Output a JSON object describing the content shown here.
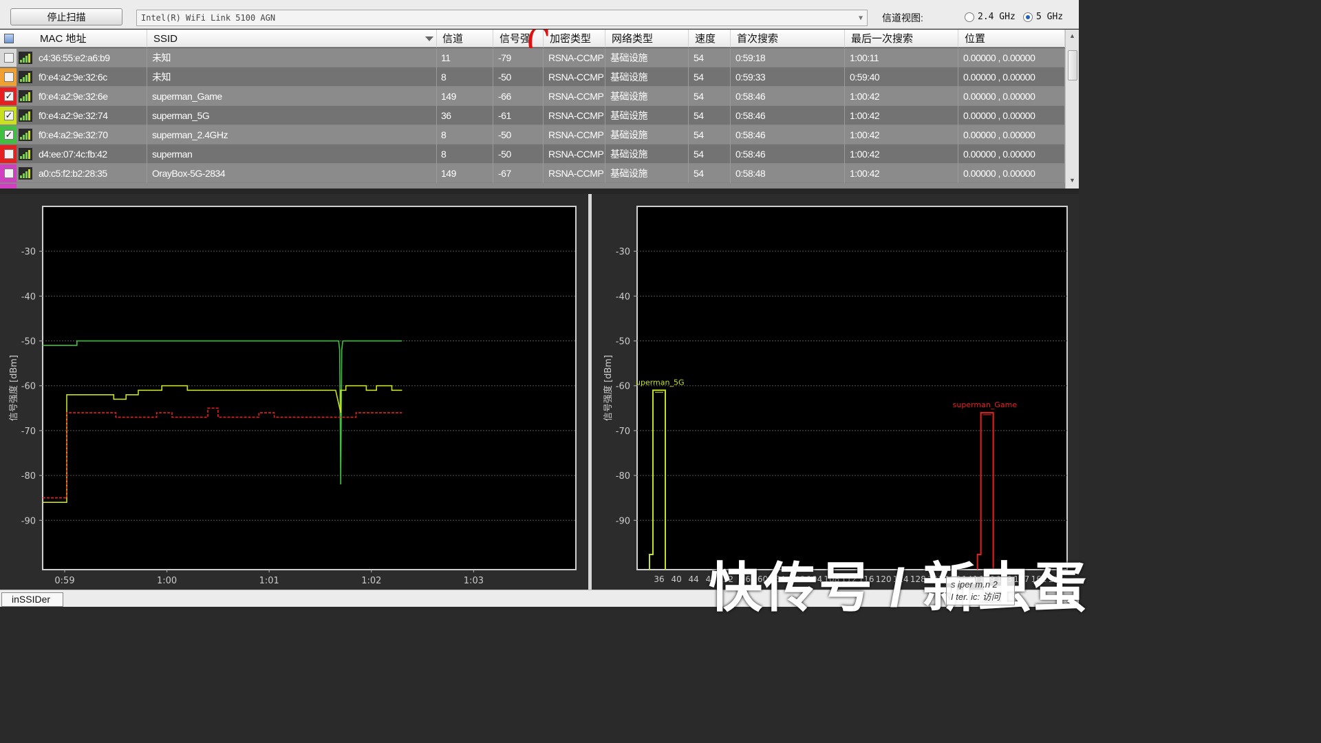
{
  "toolbar": {
    "stop_scan_label": "停止扫描",
    "adapter_value": "Intel(R) WiFi Link 5100 AGN",
    "channel_view_label": "信道视图:",
    "band_24_label": "2.4 GHz",
    "band_5_label": "5 GHz",
    "selected_band": "5 GHz"
  },
  "table": {
    "columns": [
      "MAC 地址",
      "SSID",
      "信道",
      "信号强",
      "加密类型",
      "网络类型",
      "速度",
      "首次搜索",
      "最后一次搜索",
      "位置"
    ],
    "overlay_mark": "C",
    "rows": [
      {
        "color": "#d8d8d8",
        "checked": false,
        "mac": "c4:36:55:e2:a6:b9",
        "ssid": "未知",
        "channel": "11",
        "rssi": "-79",
        "security": "RSNA-CCMP",
        "network": "基础设施",
        "speed": "54",
        "first_seen": "0:59:18",
        "last_seen": "1:00:11",
        "location": "0.00000 , 0.00000"
      },
      {
        "color": "#f0a030",
        "checked": false,
        "mac": "f0:e4:a2:9e:32:6c",
        "ssid": "未知",
        "channel": "8",
        "rssi": "-50",
        "security": "RSNA-CCMP",
        "network": "基础设施",
        "speed": "54",
        "first_seen": "0:59:33",
        "last_seen": "0:59:40",
        "location": "0.00000 , 0.00000"
      },
      {
        "color": "#e62020",
        "checked": true,
        "mac": "f0:e4:a2:9e:32:6e",
        "ssid": "superman_Game",
        "channel": "149",
        "rssi": "-66",
        "security": "RSNA-CCMP",
        "network": "基础设施",
        "speed": "54",
        "first_seen": "0:58:46",
        "last_seen": "1:00:42",
        "location": "0.00000 , 0.00000"
      },
      {
        "color": "#c8e020",
        "checked": true,
        "mac": "f0:e4:a2:9e:32:74",
        "ssid": "superman_5G",
        "channel": "36",
        "rssi": "-61",
        "security": "RSNA-CCMP",
        "network": "基础设施",
        "speed": "54",
        "first_seen": "0:58:46",
        "last_seen": "1:00:42",
        "location": "0.00000 , 0.00000"
      },
      {
        "color": "#40c040",
        "checked": true,
        "mac": "f0:e4:a2:9e:32:70",
        "ssid": "superman_2.4GHz",
        "channel": "8",
        "rssi": "-50",
        "security": "RSNA-CCMP",
        "network": "基础设施",
        "speed": "54",
        "first_seen": "0:58:46",
        "last_seen": "1:00:42",
        "location": "0.00000 , 0.00000"
      },
      {
        "color": "#e62020",
        "checked": false,
        "mac": "d4:ee:07:4c:fb:42",
        "ssid": "superman",
        "channel": "8",
        "rssi": "-50",
        "security": "RSNA-CCMP",
        "network": "基础设施",
        "speed": "54",
        "first_seen": "0:58:46",
        "last_seen": "1:00:42",
        "location": "0.00000 , 0.00000"
      },
      {
        "color": "#d040c0",
        "checked": false,
        "mac": "a0:c5:f2:b2:28:35",
        "ssid": "OrayBox-5G-2834",
        "channel": "149",
        "rssi": "-67",
        "security": "RSNA-CCMP",
        "network": "基础设施",
        "speed": "54",
        "first_seen": "0:58:48",
        "last_seen": "1:00:42",
        "location": "0.00000 , 0.00000"
      }
    ]
  },
  "chart_data": [
    {
      "type": "line",
      "ylabel": "信号强度 [dBm]",
      "xlabel": "",
      "x_ticks": [
        "0:59",
        "1:00",
        "1:01",
        "1:02",
        "1:03"
      ],
      "y_ticks": [
        -30,
        -40,
        -50,
        -60,
        -70,
        -80,
        -90
      ],
      "ylim": [
        -101,
        -20
      ],
      "xlim": [
        0,
        5
      ],
      "grid": true,
      "series": [
        {
          "color": "#40c040",
          "x": [
            0,
            0.12,
            0.12,
            2.68,
            2.69,
            2.7,
            2.71,
            2.72,
            3.3
          ],
          "y": [
            -51,
            -51,
            -50,
            -50,
            -52,
            -82,
            -52,
            -50,
            -50
          ]
        },
        {
          "color": "#c8e020",
          "x": [
            0,
            0.02,
            0.02,
            0.48,
            0.48,
            0.6,
            0.6,
            0.72,
            0.72,
            0.95,
            0.95,
            1.2,
            1.2,
            1.65,
            1.65,
            2.65,
            2.7,
            2.7,
            2.75,
            2.75,
            2.95,
            2.95,
            3.05,
            3.05,
            3.2,
            3.2,
            3.3
          ],
          "y": [
            -86,
            -86,
            -62,
            -62,
            -63,
            -63,
            -62,
            -62,
            -61,
            -61,
            -60,
            -60,
            -61,
            -61,
            -61,
            -61,
            -66,
            -61,
            -61,
            -60,
            -60,
            -61,
            -61,
            -60,
            -60,
            -61,
            -61
          ]
        },
        {
          "color": "#e62020",
          "dashed": true,
          "x": [
            0,
            0.02,
            0.02,
            0.5,
            0.5,
            0.65,
            0.65,
            0.9,
            0.9,
            1.05,
            1.05,
            1.4,
            1.4,
            1.5,
            1.5,
            1.9,
            1.9,
            2.05,
            2.05,
            2.85,
            2.85,
            3.3
          ],
          "y": [
            -85,
            -85,
            -66,
            -66,
            -67,
            -67,
            -67,
            -67,
            -66,
            -66,
            -67,
            -67,
            -65,
            -65,
            -67,
            -67,
            -66,
            -66,
            -67,
            -67,
            -66,
            -66
          ]
        }
      ]
    },
    {
      "type": "area",
      "ylabel": "信号强度 [dBm]",
      "xlabel": "",
      "x_ticks": [
        "36",
        "40",
        "44",
        "48",
        "52",
        "56",
        "60",
        "64",
        "100",
        "104",
        "108",
        "112",
        "116",
        "120",
        "124",
        "128",
        "132",
        "136",
        "140",
        "149",
        "153",
        "157",
        "161",
        "165"
      ],
      "y_ticks": [
        -30,
        -40,
        -50,
        -60,
        -70,
        -80,
        -90
      ],
      "ylim": [
        -101,
        -20
      ],
      "grid": true,
      "series": [
        {
          "name": "superman_5G",
          "label": "uperman_5G",
          "color": "#c8e020",
          "channel_index": 0,
          "rssi": -61
        },
        {
          "name": "superman_Game",
          "label": "superman_Game",
          "color": "#e62020",
          "channel_index": 19,
          "rssi": -66
        }
      ]
    }
  ],
  "statusbar": {
    "app_tab_label": "inSSIDer"
  },
  "overlay": {
    "watermark": "快传号 / 新虫蛋",
    "tooltip_line1": "s iper m.n 2",
    "tooltip_line2": "I ter. ic: 访问"
  }
}
